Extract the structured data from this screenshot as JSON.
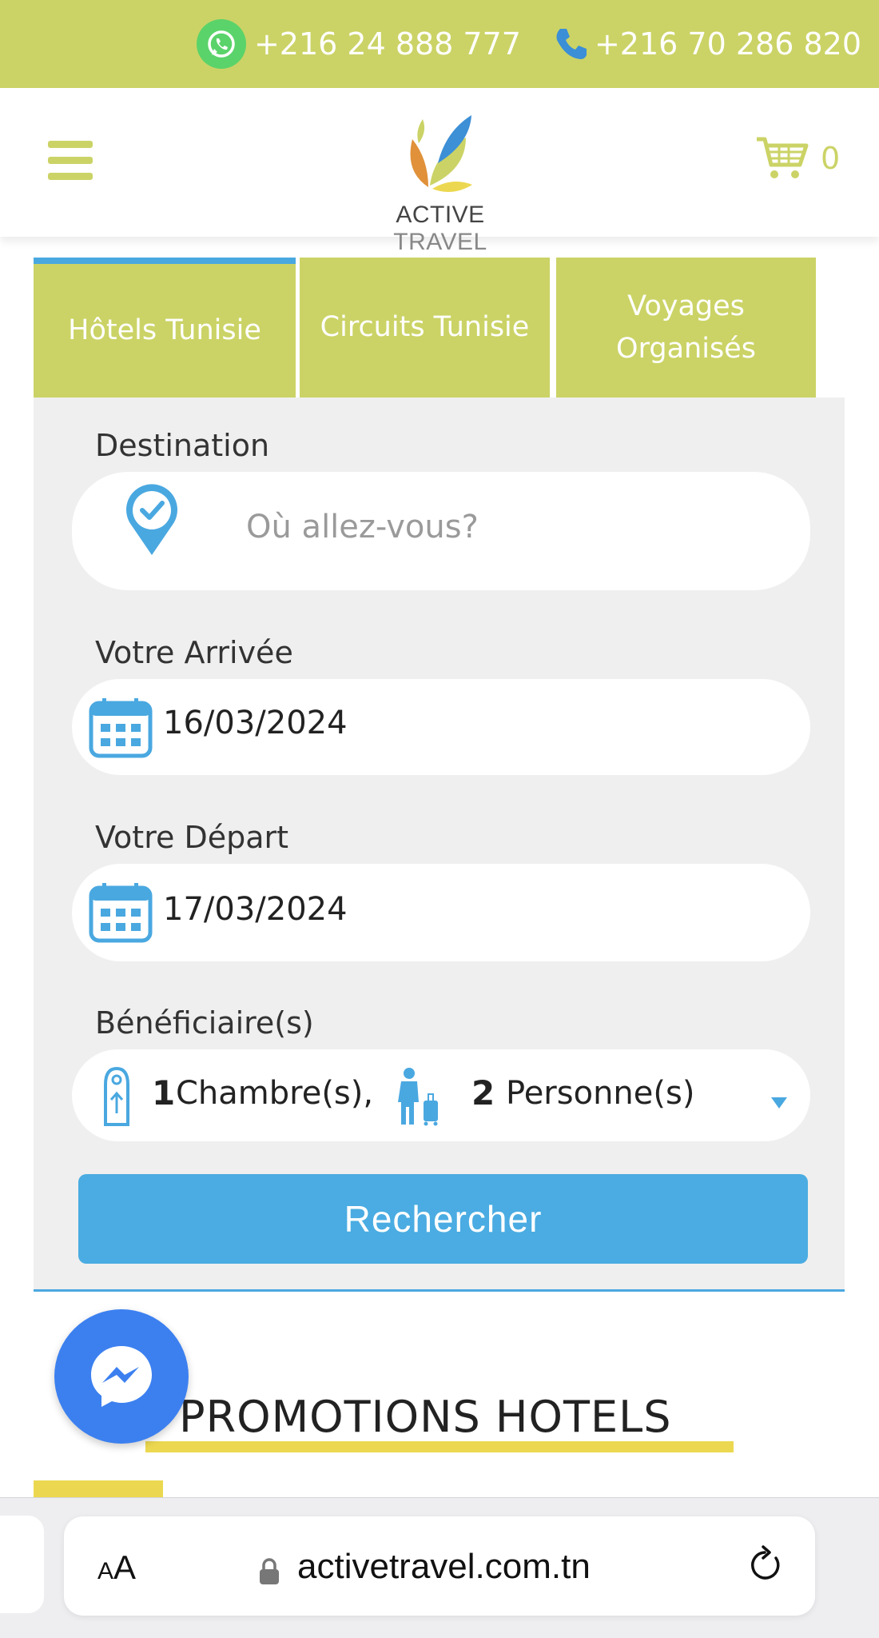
{
  "topbar": {
    "whatsapp_number": "+216 24 888 777",
    "phone_number": "+216 70 286 820",
    "whatsapp_icon": "whatsapp-icon",
    "phone_icon": "phone-icon"
  },
  "header": {
    "menu_icon": "hamburger-menu-icon",
    "logo_word1": "ACTIVE",
    "logo_word2": "TRAVEL",
    "cart_count": "0"
  },
  "tabs": [
    {
      "label": "Hôtels Tunisie",
      "active": true
    },
    {
      "label": "Circuits Tunisie",
      "active": false
    },
    {
      "label": "Voyages Organisés",
      "active": false
    }
  ],
  "form": {
    "destination_label": "Destination",
    "destination_placeholder": "Où allez-vous?",
    "arrival_label": "Votre Arrivée",
    "arrival_value": "16/03/2024",
    "departure_label": "Votre Départ",
    "departure_value": "17/03/2024",
    "beneficiaries_label": "Bénéficiaire(s)",
    "rooms_count": "1",
    "rooms_text": "Chambre(s),",
    "persons_count": "2",
    "persons_text": "Personne(s)",
    "search_button": "Rechercher"
  },
  "promo": {
    "title": "PROMOTIONS HOTELS"
  },
  "browser": {
    "text_size_label_small": "A",
    "text_size_label_large": "A",
    "url": "activetravel.com.tn"
  },
  "colors": {
    "brand_green": "#cbd366",
    "accent_blue": "#4aace2",
    "promo_yellow": "#ecd850",
    "messenger_blue": "#3c80f0"
  }
}
